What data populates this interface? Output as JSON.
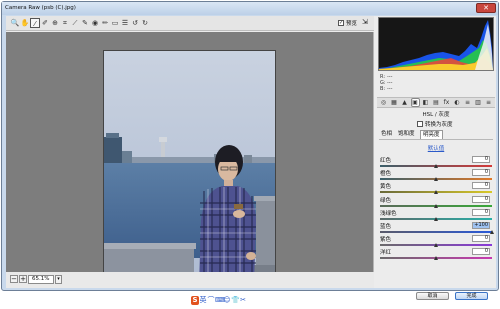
{
  "window": {
    "title": "Camera Raw (psb (C).jpg)"
  },
  "toolbar": {
    "tools": [
      {
        "name": "zoom-tool-icon",
        "glyph": "🔍"
      },
      {
        "name": "hand-tool-icon",
        "glyph": "✋"
      },
      {
        "name": "white-balance-tool-icon",
        "glyph": "⁄"
      },
      {
        "name": "color-sampler-tool-icon",
        "glyph": "✐"
      },
      {
        "name": "targeted-adjustment-tool-icon",
        "glyph": "⊕"
      },
      {
        "name": "crop-tool-icon",
        "glyph": "⌗"
      },
      {
        "name": "straighten-tool-icon",
        "glyph": "⟋"
      },
      {
        "name": "spot-removal-tool-icon",
        "glyph": "✎"
      },
      {
        "name": "red-eye-tool-icon",
        "glyph": "◉"
      },
      {
        "name": "adjustment-brush-icon",
        "glyph": "✏"
      },
      {
        "name": "graduated-filter-icon",
        "glyph": "▭"
      },
      {
        "name": "preferences-icon",
        "glyph": "☰"
      },
      {
        "name": "rotate-ccw-icon",
        "glyph": "↺"
      },
      {
        "name": "rotate-cw-icon",
        "glyph": "↻"
      }
    ],
    "preview_label": "预览",
    "preview_checked": "✓"
  },
  "statusbar": {
    "zoom_out": "−",
    "zoom_in": "+",
    "zoom": "65.1%",
    "zoom_arrow": "▾"
  },
  "readout": {
    "rows": [
      {
        "key": "R:",
        "value": "---"
      },
      {
        "key": "G:",
        "value": "---"
      },
      {
        "key": "B:",
        "value": "---"
      }
    ]
  },
  "panel_tabs": [
    {
      "name": "basic-tab-icon",
      "glyph": "◎"
    },
    {
      "name": "tone-curve-tab-icon",
      "glyph": "▦"
    },
    {
      "name": "detail-tab-icon",
      "glyph": "▲"
    },
    {
      "name": "hsl-tab-icon",
      "glyph": "▣"
    },
    {
      "name": "split-toning-tab-icon",
      "glyph": "◧"
    },
    {
      "name": "lens-corrections-tab-icon",
      "glyph": "▤"
    },
    {
      "name": "effects-tab-icon",
      "glyph": "fx"
    },
    {
      "name": "camera-calibration-tab-icon",
      "glyph": "◐"
    },
    {
      "name": "presets-tab-icon",
      "glyph": "≡"
    },
    {
      "name": "snapshots-tab-icon",
      "glyph": "▥"
    },
    {
      "name": "panel-menu-icon",
      "glyph": "≡"
    }
  ],
  "hsl": {
    "title": "HSL / 灰度",
    "convert_label": "转换为灰度",
    "subtabs": [
      "色相",
      "饱和度",
      "明亮度"
    ],
    "default_link": "默认值",
    "sliders": [
      {
        "label": "红色",
        "value": "0",
        "pct": 50,
        "track": "linear-gradient(90deg,#3a5f6a,#d43a3a)"
      },
      {
        "label": "橙色",
        "value": "0",
        "pct": 50,
        "track": "linear-gradient(90deg,#3a5f6a,#e07a2a)"
      },
      {
        "label": "黄色",
        "value": "0",
        "pct": 50,
        "track": "linear-gradient(90deg,#6a6a3a,#d8c82a)"
      },
      {
        "label": "绿色",
        "value": "0",
        "pct": 50,
        "track": "linear-gradient(90deg,#5a6a5a,#3aa83a)"
      },
      {
        "label": "浅绿色",
        "value": "0",
        "pct": 50,
        "track": "linear-gradient(90deg,#5a6a6a,#2ab0a8)"
      },
      {
        "label": "蓝色",
        "value": "+100",
        "pct": 100,
        "track": "linear-gradient(90deg,#5a5a6a,#2a5ad8)",
        "selected": true
      },
      {
        "label": "紫色",
        "value": "0",
        "pct": 50,
        "track": "linear-gradient(90deg,#6a6a6a,#8a3ad8)"
      },
      {
        "label": "洋红",
        "value": "0",
        "pct": 50,
        "track": "linear-gradient(90deg,#6a6a6a,#c83ab0)"
      }
    ]
  },
  "buttons": {
    "cancel": "取消",
    "done": "完成"
  },
  "ime_bar": {
    "items": [
      {
        "name": "sogou-icon",
        "glyph": "S"
      },
      {
        "name": "chinese-mode-icon",
        "glyph": "英"
      },
      {
        "name": "punctuation-icon",
        "glyph": "⌒"
      },
      {
        "name": "soft-keyboard-icon",
        "glyph": "⌨"
      },
      {
        "name": "emoticon-icon",
        "glyph": "☺"
      },
      {
        "name": "skin-icon",
        "glyph": "👕"
      },
      {
        "name": "tools-icon",
        "glyph": "✂"
      }
    ]
  },
  "colors": {
    "ime_red": "#e2521d",
    "link_blue": "#2b5ac9",
    "selected_value_bg": "#9fc2f0"
  }
}
